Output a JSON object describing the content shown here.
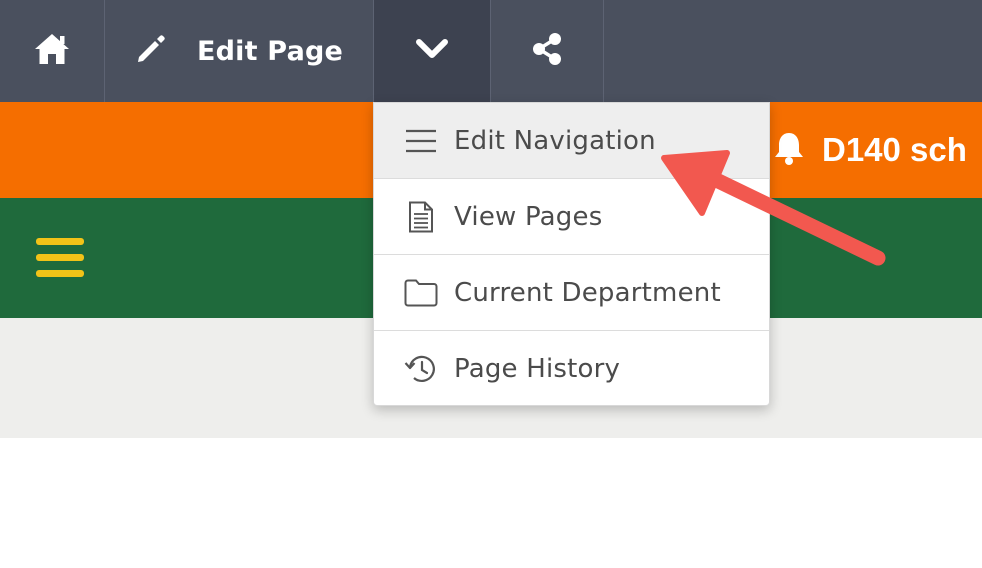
{
  "toolbar": {
    "edit_label": "Edit Page",
    "icons": {
      "home": "home-icon",
      "edit": "pencil-icon",
      "more": "chevron-down-icon",
      "share": "share-icon"
    },
    "colors": {
      "background": "#4a505e",
      "active_background": "#3d4250"
    }
  },
  "alert": {
    "text": "D140 sch",
    "icon": "bell-icon",
    "color": "#f56e00"
  },
  "navbar": {
    "menu_icon": "hamburger-icon",
    "color": "#1f6a3c",
    "menu_color": "#f2c318"
  },
  "dropdown": {
    "items": [
      {
        "label": "Edit Navigation",
        "icon": "list-icon"
      },
      {
        "label": "View Pages",
        "icon": "document-icon"
      },
      {
        "label": "Current Department",
        "icon": "folder-icon"
      },
      {
        "label": "Page History",
        "icon": "history-icon"
      }
    ]
  },
  "annotation": {
    "type": "arrow",
    "color": "#f2584f",
    "points_to": "Edit Navigation"
  }
}
